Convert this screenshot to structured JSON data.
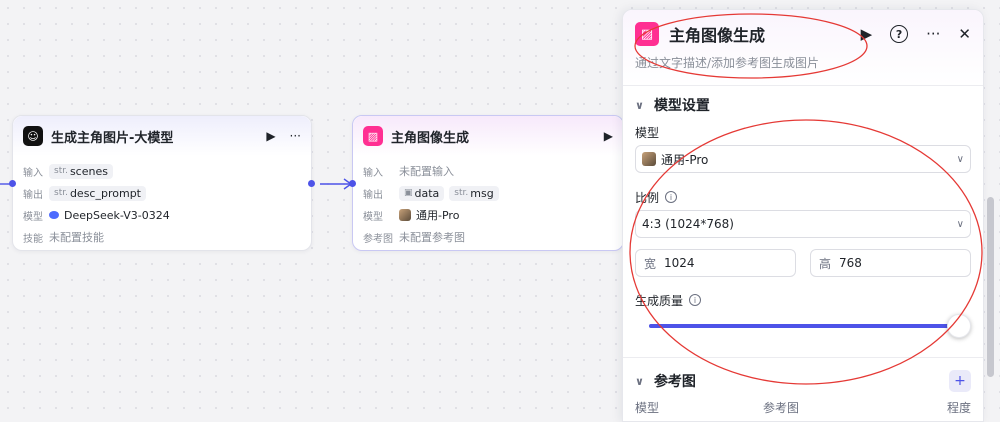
{
  "node_llm": {
    "title": "生成主角图片-大模型",
    "rows": [
      {
        "label": "输入",
        "tags": [
          {
            "prefix": "str.",
            "text": "scenes"
          }
        ]
      },
      {
        "label": "输出",
        "tags": [
          {
            "prefix": "str.",
            "text": "desc_prompt"
          }
        ]
      },
      {
        "label": "模型",
        "value": "DeepSeek-V3-0324"
      },
      {
        "label": "技能",
        "value": "未配置技能"
      }
    ]
  },
  "node_img": {
    "title": "主角图像生成",
    "rows": [
      {
        "label": "输入",
        "value": "未配置输入"
      },
      {
        "label": "输出",
        "tags": [
          {
            "prefix": "▣",
            "text": "data"
          },
          {
            "prefix": "str.",
            "text": "msg"
          }
        ]
      },
      {
        "label": "模型",
        "value": "通用-Pro"
      },
      {
        "label": "参考图",
        "value": "未配置参考图"
      }
    ]
  },
  "panel": {
    "title": "主角图像生成",
    "description": "通过文字描述/添加参考图生成图片",
    "model_section": {
      "title": "模型设置",
      "model_label": "模型",
      "model_value": "通用-Pro",
      "ratio_label": "比例",
      "ratio_value": "4:3 (1024*768)",
      "width_label": "宽",
      "width_value": "1024",
      "height_label": "高",
      "height_value": "768",
      "quality_label": "生成质量",
      "quality_fraction": 1.0
    },
    "ref_section": {
      "title": "参考图",
      "columns": [
        "模型",
        "参考图",
        "程度"
      ]
    }
  },
  "colors": {
    "accent": "#4d53e8",
    "image_node_icon": "#ff2f92",
    "annotation": "#e53935"
  }
}
